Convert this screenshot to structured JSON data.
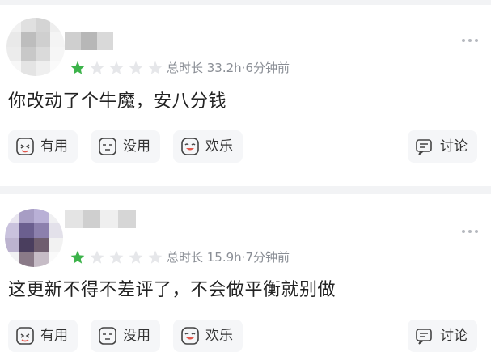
{
  "reviews": [
    {
      "star_rating": 1,
      "star_max": 5,
      "meta": "总时长 33.2h·6分钟前",
      "content": "你改动了个牛魔，安八分钱",
      "actions": {
        "useful": "有用",
        "useless": "没用",
        "funny": "欢乐",
        "discuss": "讨论"
      }
    },
    {
      "star_rating": 1,
      "star_max": 5,
      "meta": "总时长 15.9h·7分钟前",
      "content": "这更新不得不差评了，不会做平衡就别做",
      "actions": {
        "useful": "有用",
        "useless": "没用",
        "funny": "欢乐",
        "discuss": "讨论"
      }
    }
  ],
  "colors": {
    "star_filled": "#3cb34a",
    "star_empty": "#e6e7ea",
    "meta_text": "#8a8e95",
    "button_bg": "#f5f6f8"
  },
  "icons": {
    "more": "more-dots-icon",
    "useful": "thumbs-up-face-icon",
    "useless": "blank-face-icon",
    "funny": "laughing-face-icon",
    "discuss": "discuss-bubble-icon"
  }
}
